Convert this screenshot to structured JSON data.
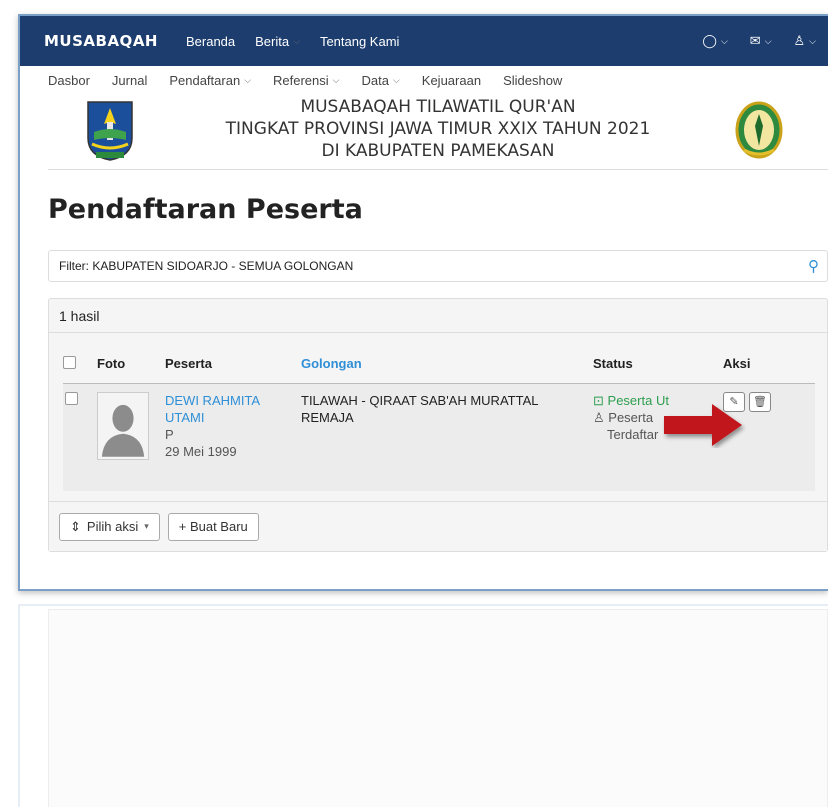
{
  "topbar": {
    "brand": "MUSABAQAH",
    "nav": [
      {
        "label": "Beranda",
        "has_dropdown": false
      },
      {
        "label": "Berita",
        "has_dropdown": true
      },
      {
        "label": "Tentang Kami",
        "has_dropdown": false
      }
    ],
    "right_icons": [
      "chat-icon",
      "mail-icon",
      "user-icon"
    ]
  },
  "subnav": [
    {
      "label": "Dasbor",
      "has_dropdown": false
    },
    {
      "label": "Jurnal",
      "has_dropdown": false
    },
    {
      "label": "Pendaftaran",
      "has_dropdown": true
    },
    {
      "label": "Referensi",
      "has_dropdown": true
    },
    {
      "label": "Data",
      "has_dropdown": true
    },
    {
      "label": "Kejuaraan",
      "has_dropdown": false
    },
    {
      "label": "Slideshow",
      "has_dropdown": false
    }
  ],
  "banner": {
    "line1": "MUSABAQAH TILAWATIL QUR'AN",
    "line2": "TINGKAT PROVINSI JAWA TIMUR XXIX TAHUN 2021",
    "line3": "DI KABUPATEN PAMEKASAN"
  },
  "page_title": "Pendaftaran Peserta",
  "filter": {
    "text": "Filter: KABUPATEN SIDOARJO - SEMUA GOLONGAN"
  },
  "results": {
    "count_label": "1 hasil",
    "columns": {
      "foto": "Foto",
      "peserta": "Peserta",
      "golongan": "Golongan",
      "status": "Status",
      "aksi": "Aksi"
    },
    "rows": [
      {
        "name_line1": "DEWI RAHMITA",
        "name_line2": "UTAMI",
        "gender": "P",
        "dob": "29 Mei 1999",
        "golongan_line1": "TILAWAH - QIRAAT SAB'AH MURATTAL",
        "golongan_line2": "REMAJA",
        "status_primary": "Peserta Ut",
        "status_secondary_line1": "Peserta",
        "status_secondary_line2": "Terdaftar"
      }
    ]
  },
  "footer": {
    "pilih_aksi": "Pilih aksi",
    "buat_baru": "+ Buat Baru"
  },
  "colors": {
    "topbar": "#1c3d6e",
    "link": "#2e8fd6",
    "status_green": "#2e9e4f",
    "arrow": "#c0161b"
  }
}
